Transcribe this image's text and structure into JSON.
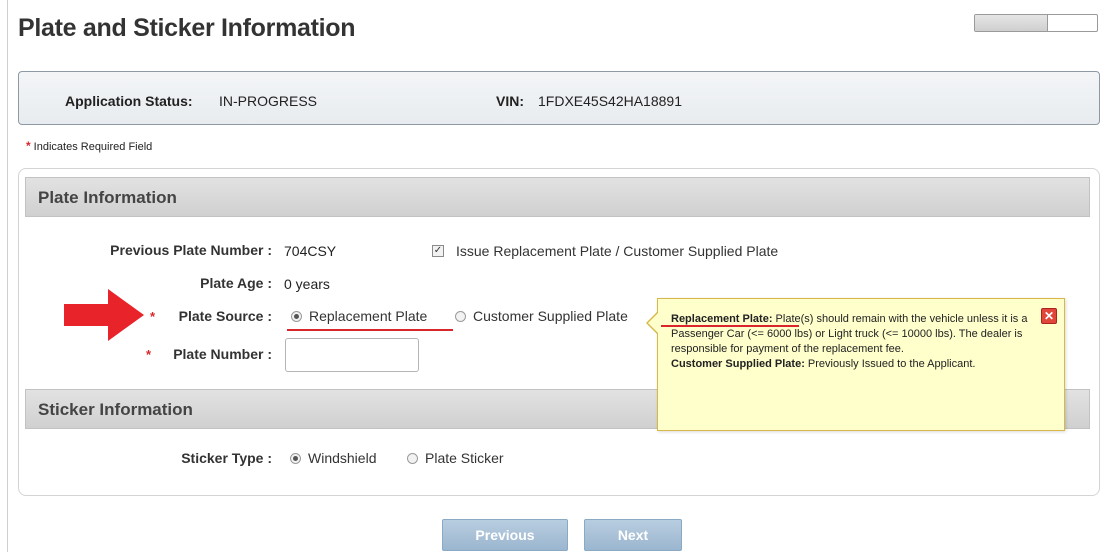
{
  "page": {
    "title": "Plate and Sticker Information"
  },
  "progress": {
    "fraction": 0.6
  },
  "status": {
    "app_status_label": "Application Status:",
    "app_status_value": "IN-PROGRESS",
    "vin_label": "VIN:",
    "vin_value": "1FDXE45S42HA18891"
  },
  "required_note": {
    "star": "*",
    "text": "Indicates Required Field"
  },
  "plate_section": {
    "title": "Plate Information",
    "previous_plate_label": "Previous Plate Number :",
    "previous_plate_value": "704CSY",
    "issue_replacement_label": "Issue Replacement Plate / Customer Supplied Plate",
    "issue_replacement_checked": true,
    "plate_age_label": "Plate Age :",
    "plate_age_value": "0 years",
    "plate_source_label": "Plate Source :",
    "plate_source_options": [
      "Replacement Plate",
      "Customer Supplied Plate"
    ],
    "plate_source_selected": "Replacement Plate",
    "plate_number_label": "Plate Number :",
    "plate_number_value": ""
  },
  "tooltip": {
    "term1": "Replacement Plate:",
    "text1": " Plate(s) should remain with the vehicle unless it is a Passenger Car (<= 6000 lbs) or Light truck (<= 10000 lbs). The dealer is responsible for payment of the replacement fee.",
    "term2": "Customer Supplied Plate:",
    "text2": " Previously Issued to the Applicant.",
    "close_icon": "close-icon"
  },
  "sticker_section": {
    "title": "Sticker Information",
    "sticker_type_label": "Sticker Type :",
    "options": [
      "Windshield",
      "Plate Sticker"
    ],
    "selected": "Windshield"
  },
  "buttons": {
    "previous": "Previous",
    "next": "Next"
  },
  "colors": {
    "required_red": "#d9262c",
    "tooltip_bg": "#ffffcc",
    "button_blue": "#9bb6cf"
  }
}
